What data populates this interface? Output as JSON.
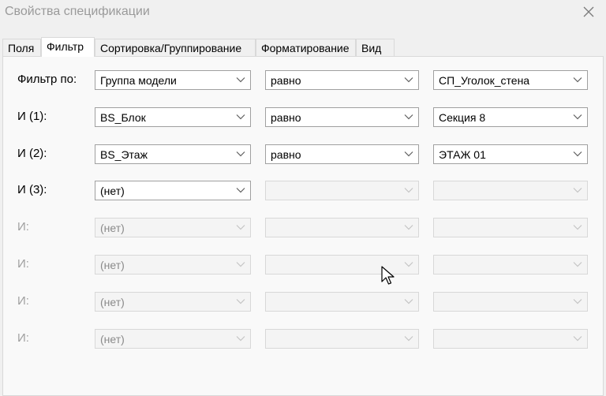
{
  "window": {
    "title": "Свойства спецификации",
    "close_icon": "close-icon"
  },
  "tabs": [
    {
      "label": "Поля",
      "active": false
    },
    {
      "label": "Фильтр",
      "active": true
    },
    {
      "label": "Сортировка/Группирование",
      "active": false
    },
    {
      "label": "Форматирование",
      "active": false
    },
    {
      "label": "Вид",
      "active": false
    }
  ],
  "filters": [
    {
      "label": "Фильтр по:",
      "field": "Группа модели",
      "operator": "равно",
      "value": "СП_Уголок_стена",
      "enabled": true
    },
    {
      "label": "И (1):",
      "field": "BS_Блок",
      "operator": "равно",
      "value": "Секция 8",
      "enabled": true
    },
    {
      "label": "И (2):",
      "field": "BS_Этаж",
      "operator": "равно",
      "value": "ЭТАЖ 01",
      "enabled": true
    },
    {
      "label": "И (3):",
      "field": "(нет)",
      "operator": "",
      "value": "",
      "enabled": true
    },
    {
      "label": "И:",
      "field": "(нет)",
      "operator": "",
      "value": "",
      "enabled": false
    },
    {
      "label": "И:",
      "field": "(нет)",
      "operator": "",
      "value": "",
      "enabled": false
    },
    {
      "label": "И:",
      "field": "(нет)",
      "operator": "",
      "value": "",
      "enabled": false
    },
    {
      "label": "И:",
      "field": "(нет)",
      "operator": "",
      "value": "",
      "enabled": false
    }
  ],
  "colors": {
    "panel_bg": "#f9f9f9",
    "window_bg": "#f0f0f0",
    "disabled_text": "#a0a0a0"
  }
}
